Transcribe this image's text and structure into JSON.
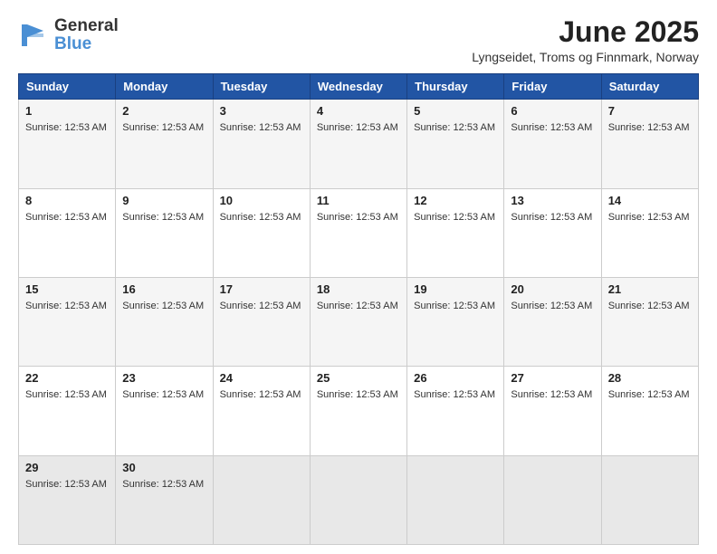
{
  "header": {
    "logo_line1": "General",
    "logo_line2": "Blue",
    "month_year": "June 2025",
    "location": "Lyngseidet, Troms og Finnmark, Norway"
  },
  "calendar": {
    "days_of_week": [
      "Sunday",
      "Monday",
      "Tuesday",
      "Wednesday",
      "Thursday",
      "Friday",
      "Saturday"
    ],
    "sunrise_time": "Sunrise: 12:53 AM",
    "weeks": [
      [
        {
          "day": "1",
          "sunrise": "Sunrise: 12:53 AM"
        },
        {
          "day": "2",
          "sunrise": "Sunrise: 12:53 AM"
        },
        {
          "day": "3",
          "sunrise": "Sunrise: 12:53 AM"
        },
        {
          "day": "4",
          "sunrise": "Sunrise: 12:53 AM"
        },
        {
          "day": "5",
          "sunrise": "Sunrise: 12:53 AM"
        },
        {
          "day": "6",
          "sunrise": "Sunrise: 12:53 AM"
        },
        {
          "day": "7",
          "sunrise": "Sunrise: 12:53 AM"
        }
      ],
      [
        {
          "day": "8",
          "sunrise": "Sunrise: 12:53 AM"
        },
        {
          "day": "9",
          "sunrise": "Sunrise: 12:53 AM"
        },
        {
          "day": "10",
          "sunrise": "Sunrise: 12:53 AM"
        },
        {
          "day": "11",
          "sunrise": "Sunrise: 12:53 AM"
        },
        {
          "day": "12",
          "sunrise": "Sunrise: 12:53 AM"
        },
        {
          "day": "13",
          "sunrise": "Sunrise: 12:53 AM"
        },
        {
          "day": "14",
          "sunrise": "Sunrise: 12:53 AM"
        }
      ],
      [
        {
          "day": "15",
          "sunrise": "Sunrise: 12:53 AM"
        },
        {
          "day": "16",
          "sunrise": "Sunrise: 12:53 AM"
        },
        {
          "day": "17",
          "sunrise": "Sunrise: 12:53 AM"
        },
        {
          "day": "18",
          "sunrise": "Sunrise: 12:53 AM"
        },
        {
          "day": "19",
          "sunrise": "Sunrise: 12:53 AM"
        },
        {
          "day": "20",
          "sunrise": "Sunrise: 12:53 AM"
        },
        {
          "day": "21",
          "sunrise": "Sunrise: 12:53 AM"
        }
      ],
      [
        {
          "day": "22",
          "sunrise": "Sunrise: 12:53 AM"
        },
        {
          "day": "23",
          "sunrise": "Sunrise: 12:53 AM"
        },
        {
          "day": "24",
          "sunrise": "Sunrise: 12:53 AM"
        },
        {
          "day": "25",
          "sunrise": "Sunrise: 12:53 AM"
        },
        {
          "day": "26",
          "sunrise": "Sunrise: 12:53 AM"
        },
        {
          "day": "27",
          "sunrise": "Sunrise: 12:53 AM"
        },
        {
          "day": "28",
          "sunrise": "Sunrise: 12:53 AM"
        }
      ],
      [
        {
          "day": "29",
          "sunrise": "Sunrise: 12:53 AM"
        },
        {
          "day": "30",
          "sunrise": "Sunrise: 12:53 AM"
        },
        {
          "day": "",
          "sunrise": ""
        },
        {
          "day": "",
          "sunrise": ""
        },
        {
          "day": "",
          "sunrise": ""
        },
        {
          "day": "",
          "sunrise": ""
        },
        {
          "day": "",
          "sunrise": ""
        }
      ]
    ]
  }
}
